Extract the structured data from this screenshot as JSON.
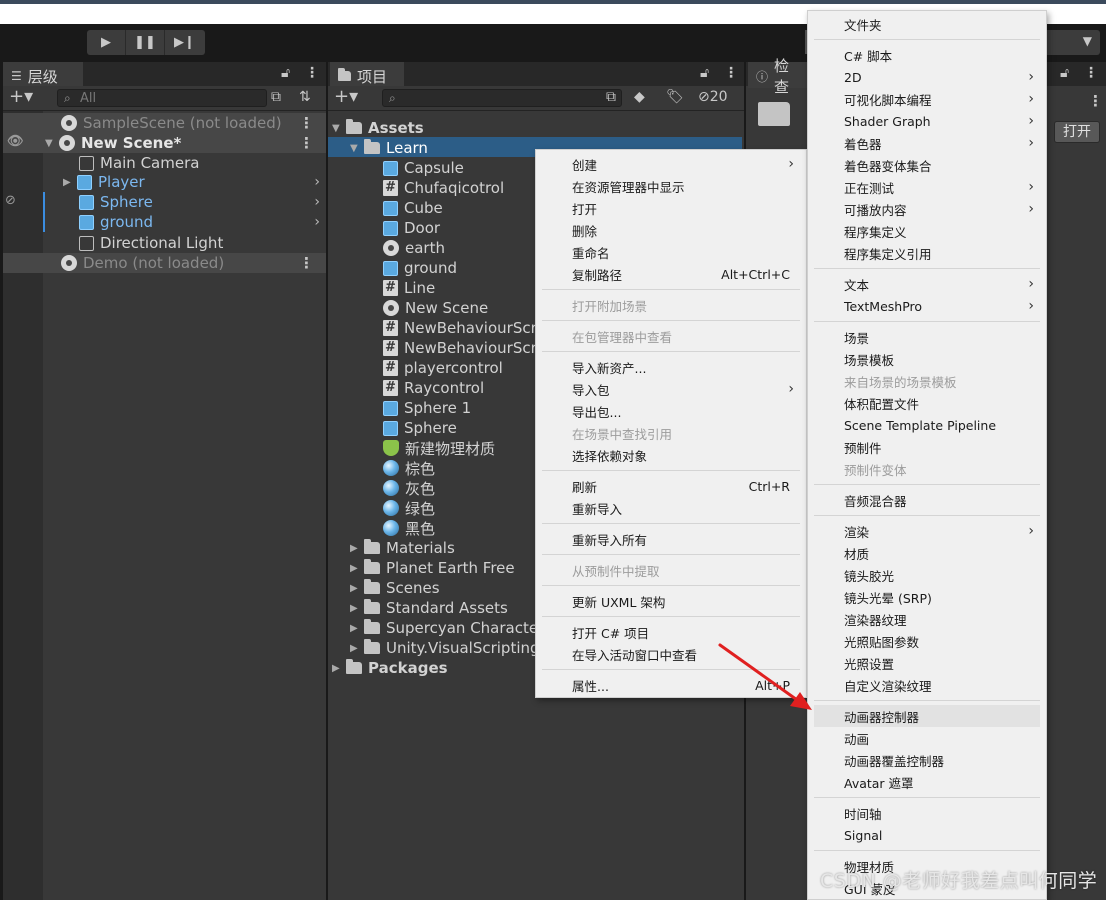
{
  "hierarchy": {
    "tab": "层级",
    "search_placeholder": "All",
    "rows": [
      {
        "label": "SampleScene (not loaded)"
      },
      {
        "label": "New Scene*"
      },
      {
        "label": "Main Camera"
      },
      {
        "label": "Player"
      },
      {
        "label": "Sphere"
      },
      {
        "label": "ground"
      },
      {
        "label": "Directional Light"
      },
      {
        "label": "Demo (not loaded)"
      }
    ]
  },
  "project": {
    "tab": "项目",
    "hidden_count": "20",
    "items": [
      "Assets",
      "Learn",
      "Capsule",
      "Chufaqicotrol",
      "Cube",
      "Door",
      "earth",
      "ground",
      "Line",
      "New Scene",
      "NewBehaviourScr",
      "NewBehaviourScr",
      "playercontrol",
      "Raycontrol",
      "Sphere 1",
      "Sphere",
      "新建物理材质",
      "棕色",
      "灰色",
      "绿色",
      "黑色",
      "Materials",
      "Planet Earth Free",
      "Scenes",
      "Standard Assets",
      "Supercyan Characte",
      "Unity.VisualScripting",
      "Packages"
    ]
  },
  "inspector": {
    "tab": "检查",
    "open_button": "打开"
  },
  "context_menu": {
    "items": [
      {
        "label": "创建"
      },
      {
        "label": "在资源管理器中显示"
      },
      {
        "label": "打开"
      },
      {
        "label": "删除"
      },
      {
        "label": "重命名"
      },
      {
        "label": "复制路径",
        "shortcut": "Alt+Ctrl+C"
      },
      {
        "label": "打开附加场景"
      },
      {
        "label": "在包管理器中查看"
      },
      {
        "label": "导入新资产..."
      },
      {
        "label": "导入包"
      },
      {
        "label": "导出包..."
      },
      {
        "label": "在场景中查找引用"
      },
      {
        "label": "选择依赖对象"
      },
      {
        "label": "刷新",
        "shortcut": "Ctrl+R"
      },
      {
        "label": "重新导入"
      },
      {
        "label": "重新导入所有"
      },
      {
        "label": "从预制件中提取"
      },
      {
        "label": "更新 UXML 架构"
      },
      {
        "label": "打开 C# 项目"
      },
      {
        "label": "在导入活动窗口中查看"
      },
      {
        "label": "属性...",
        "shortcut": "Alt+P"
      }
    ]
  },
  "create_submenu": {
    "items": [
      "文件夹",
      "C# 脚本",
      "2D",
      "可视化脚本编程",
      "Shader Graph",
      "着色器",
      "着色器变体集合",
      "正在测试",
      "可播放内容",
      "程序集定义",
      "程序集定义引用",
      "文本",
      "TextMeshPro",
      "场景",
      "场景模板",
      "来自场景的场景模板",
      "体积配置文件",
      "Scene Template Pipeline",
      "预制件",
      "预制件变体",
      "音频混合器",
      "渲染",
      "材质",
      "镜头胶光",
      "镜头光晕 (SRP)",
      "渲染器纹理",
      "光照贴图参数",
      "光照设置",
      "自定义渲染纹理",
      "动画器控制器",
      "动画",
      "动画器覆盖控制器",
      "Avatar 遮罩",
      "时间轴",
      "Signal",
      "物理材质",
      "GUI 蒙皮"
    ]
  },
  "watermark": "CSDN @老师好我差点叫何同学",
  "colors": {
    "selection": "#2c5d87",
    "arrow": "#e02020",
    "link_blue": "#7cb8f0"
  }
}
